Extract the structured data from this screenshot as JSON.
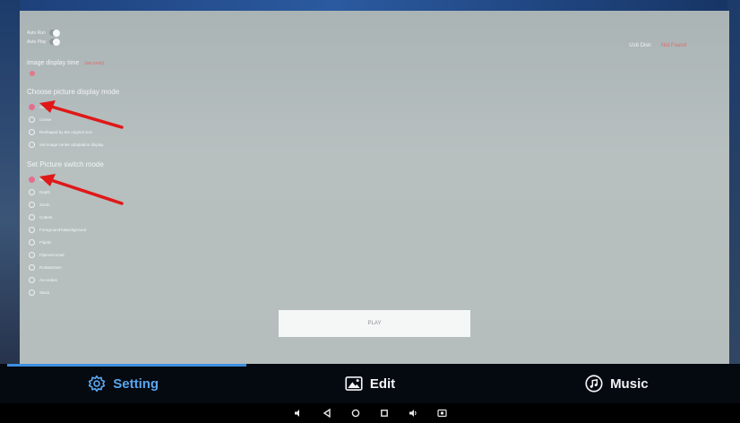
{
  "toggles": [
    {
      "label": "Auto Run",
      "on": true
    },
    {
      "label": "Auto Play",
      "on": true
    }
  ],
  "usb_disk": {
    "label": "Usb Disk:",
    "value": "Not Found"
  },
  "image_display_time": {
    "label": "Image display time",
    "value": "(seconds)"
  },
  "display_mode": {
    "title": "Choose picture display mode",
    "options": [
      {
        "label": "Adapt",
        "checked": true
      },
      {
        "label": "Center",
        "checked": false
      },
      {
        "label": "Reshaped by the original size",
        "checked": false
      },
      {
        "label": "Set image center adaptation display",
        "checked": false
      }
    ]
  },
  "switch_mode": {
    "title": "Set Picture switch mode",
    "options": [
      {
        "label": "Normal",
        "checked": true
      },
      {
        "label": "Depth",
        "checked": false
      },
      {
        "label": "Zoom",
        "checked": false
      },
      {
        "label": "CubeIn",
        "checked": false
      },
      {
        "label": "ForegroundToBackground",
        "checked": false
      },
      {
        "label": "Flip3D",
        "checked": false
      },
      {
        "label": "FlipHorizontal",
        "checked": false
      },
      {
        "label": "RotateDown",
        "checked": false
      },
      {
        "label": "Accordion",
        "checked": false
      },
      {
        "label": "Stack",
        "checked": false
      }
    ]
  },
  "play_button": {
    "label": "PLAY"
  },
  "tabs": [
    {
      "label": "Setting",
      "icon": "gear-icon",
      "active": true
    },
    {
      "label": "Edit",
      "icon": "image-icon",
      "active": false
    },
    {
      "label": "Music",
      "icon": "music-note-icon",
      "active": false
    }
  ],
  "system_nav": [
    "volume-down-icon",
    "back-icon",
    "home-icon",
    "recents-icon",
    "volume-up-icon",
    "screenshot-icon"
  ],
  "colors": {
    "accent_blue": "#58a7ef",
    "radio_checked": "#e36f8e",
    "annotation_arrow": "#e01818",
    "status_red": "#e36a6a"
  }
}
